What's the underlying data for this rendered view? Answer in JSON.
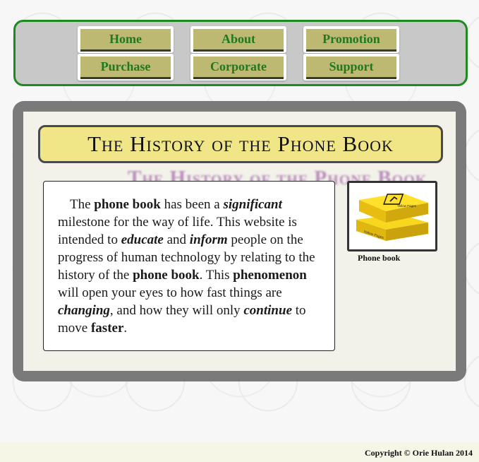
{
  "nav": {
    "items": [
      {
        "label": "Home"
      },
      {
        "label": "About"
      },
      {
        "label": "Promotion"
      },
      {
        "label": "Purchase"
      },
      {
        "label": "Corporate"
      },
      {
        "label": "Support"
      }
    ]
  },
  "main": {
    "title": "The History of the Phone Book",
    "title_shadow": "The History of the Phone Book",
    "paragraph": {
      "segments": [
        {
          "t": "The ",
          "s": "n"
        },
        {
          "t": "phone book",
          "s": "b"
        },
        {
          "t": " has been a ",
          "s": "n"
        },
        {
          "t": "significant",
          "s": "bi"
        },
        {
          "t": " milestone for the way of life. This website is intended to ",
          "s": "n"
        },
        {
          "t": "educate",
          "s": "bi"
        },
        {
          "t": " and ",
          "s": "n"
        },
        {
          "t": "inform",
          "s": "bi"
        },
        {
          "t": " people on the progress of human technology by relating to the history of the ",
          "s": "n"
        },
        {
          "t": "phone book",
          "s": "b"
        },
        {
          "t": ". This ",
          "s": "n"
        },
        {
          "t": "phenomenon",
          "s": "b"
        },
        {
          "t": " will open your eyes to how fast things are ",
          "s": "n"
        },
        {
          "t": "changing",
          "s": "bi"
        },
        {
          "t": ", and how they will only ",
          "s": "n"
        },
        {
          "t": "continue",
          "s": "bi"
        },
        {
          "t": " to move ",
          "s": "n"
        },
        {
          "t": "faster",
          "s": "b"
        },
        {
          "t": ".",
          "s": "n"
        }
      ]
    },
    "image": {
      "icon": "phone-book-image",
      "caption": "Phone book",
      "cover_text_top": "Yellow Pages",
      "cover_text_bottom": "Yellow Pages"
    }
  },
  "footer": {
    "copyright": "Copyright © Orie Hulan 2014"
  },
  "colors": {
    "nav_border": "#1f8a1f",
    "nav_bg": "#c8c8c8",
    "button_face": "#bdb872",
    "button_text": "#1f7a1f",
    "title_bg": "#f1e687",
    "panel_dark": "#7a7a7a",
    "panel_light": "#f2f1ea",
    "book_yellow": "#f5d31a"
  }
}
